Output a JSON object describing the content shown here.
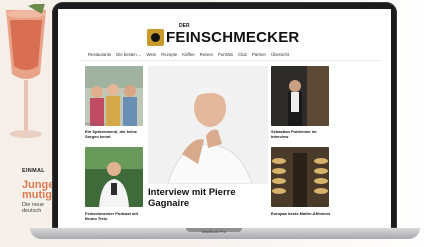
{
  "background": {
    "eyebrow": "EINMAL",
    "headline_line1": "Junge",
    "headline_line2": "mutig",
    "sub_line1": "Die neue",
    "sub_line2": "deutsch"
  },
  "laptop": {
    "base_label": "MacBook Pro"
  },
  "site": {
    "logo_small": "DER",
    "logo_main": "FEINSCHMECKER",
    "nav": [
      "Restaurants",
      "Die besten ...",
      "Wein",
      "Rezepte",
      "Kaffee",
      "Reisen",
      "Porträts",
      "Club",
      "Partner",
      "Übersicht"
    ]
  },
  "articles": {
    "top_left": {
      "promo": "PROMOTION",
      "title": "Ein Spitzenmenü, der keine Sorgen kennt"
    },
    "featured": {
      "title": "Interview mit Pierre Gagnaire"
    },
    "top_right": {
      "title": "Sebastian Poldreiner im Interview"
    },
    "bottom_left": {
      "title": "Feinschmecker Podcast mit Bruno Treiu"
    },
    "bottom_right": {
      "title": "Europas beste Maître-Affineurs"
    }
  },
  "colors": {
    "accent_orange": "#d97b52",
    "logo_gold": "#c79a2b",
    "laptop_frame": "#1c1c1e"
  }
}
